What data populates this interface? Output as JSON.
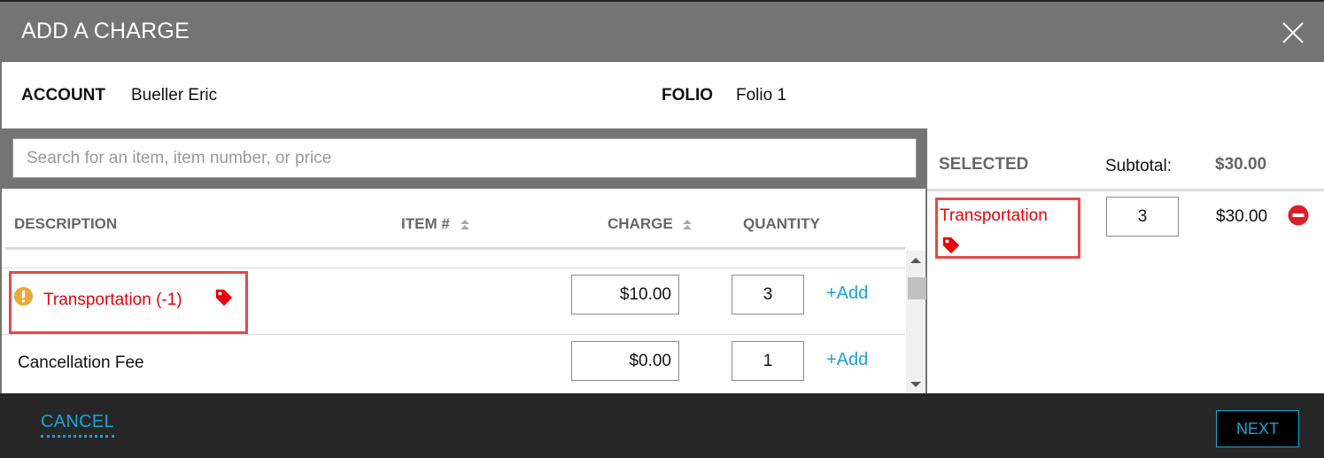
{
  "dialog": {
    "title": "ADD A CHARGE",
    "close_icon": "close-icon"
  },
  "account": {
    "account_label": "ACCOUNT",
    "account_value": "Bueller Eric",
    "folio_label": "FOLIO",
    "folio_value": "Folio 1"
  },
  "search": {
    "placeholder": "Search for an item, item number, or price",
    "value": ""
  },
  "table": {
    "columns": {
      "description": "DESCRIPTION",
      "item_number": "ITEM #",
      "charge": "CHARGE",
      "quantity": "QUANTITY"
    },
    "rows": [
      {
        "description": "Transportation (-1)",
        "status_icon": "warning-icon",
        "tag_icon": "price-tag-icon",
        "highlighted": true,
        "charge": "$10.00",
        "quantity": "3",
        "add_label": "+Add"
      },
      {
        "description": "Cancellation Fee",
        "charge": "$0.00",
        "quantity": "1",
        "add_label": "+Add"
      }
    ]
  },
  "selected": {
    "title": "SELECTED",
    "subtotal_label": "Subtotal:",
    "subtotal_value": "$30.00",
    "items": [
      {
        "name": "Transportation",
        "tag_icon": "price-tag-icon",
        "quantity": "3",
        "amount": "$30.00",
        "remove_icon": "remove-icon"
      }
    ]
  },
  "footer": {
    "cancel_label": "CANCEL",
    "next_label": "NEXT"
  },
  "colors": {
    "header_bg": "#747474",
    "footer_bg": "#262626",
    "accent": "#1aa3d4",
    "alert_text": "#e8000b",
    "highlight_border": "#e5494a",
    "warning": "#e8a93a",
    "remove": "#d9202a"
  }
}
